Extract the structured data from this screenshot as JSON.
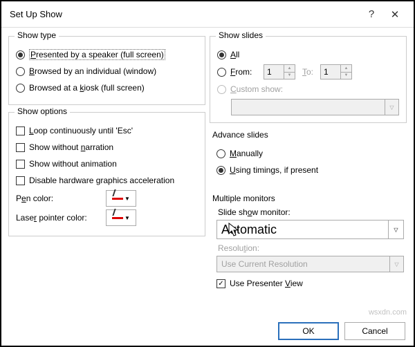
{
  "title": "Set Up Show",
  "show_type": {
    "legend": "Show type",
    "opt1": "Presented by a speaker (full screen)",
    "opt2": "Browsed by an individual (window)",
    "opt3": "Browsed at a kiosk (full screen)"
  },
  "show_options": {
    "legend": "Show options",
    "loop": "Loop continuously until 'Esc'",
    "no_narration": "Show without narration",
    "no_animation": "Show without animation",
    "disable_hw": "Disable hardware graphics acceleration",
    "pen_label": "Pen color:",
    "laser_label": "Laser pointer color:"
  },
  "show_slides": {
    "legend": "Show slides",
    "all": "All",
    "from": "From:",
    "to": "To:",
    "from_val": "1",
    "to_val": "1",
    "custom": "Custom show:"
  },
  "advance": {
    "legend": "Advance slides",
    "manually": "Manually",
    "timings": "Using timings, if present"
  },
  "monitors": {
    "legend": "Multiple monitors",
    "slide_monitor_label": "Slide show monitor:",
    "slide_monitor_val": "Automatic",
    "resolution_label": "Resolution:",
    "resolution_val": "Use Current Resolution",
    "presenter": "Use Presenter View"
  },
  "buttons": {
    "ok": "OK",
    "cancel": "Cancel"
  }
}
